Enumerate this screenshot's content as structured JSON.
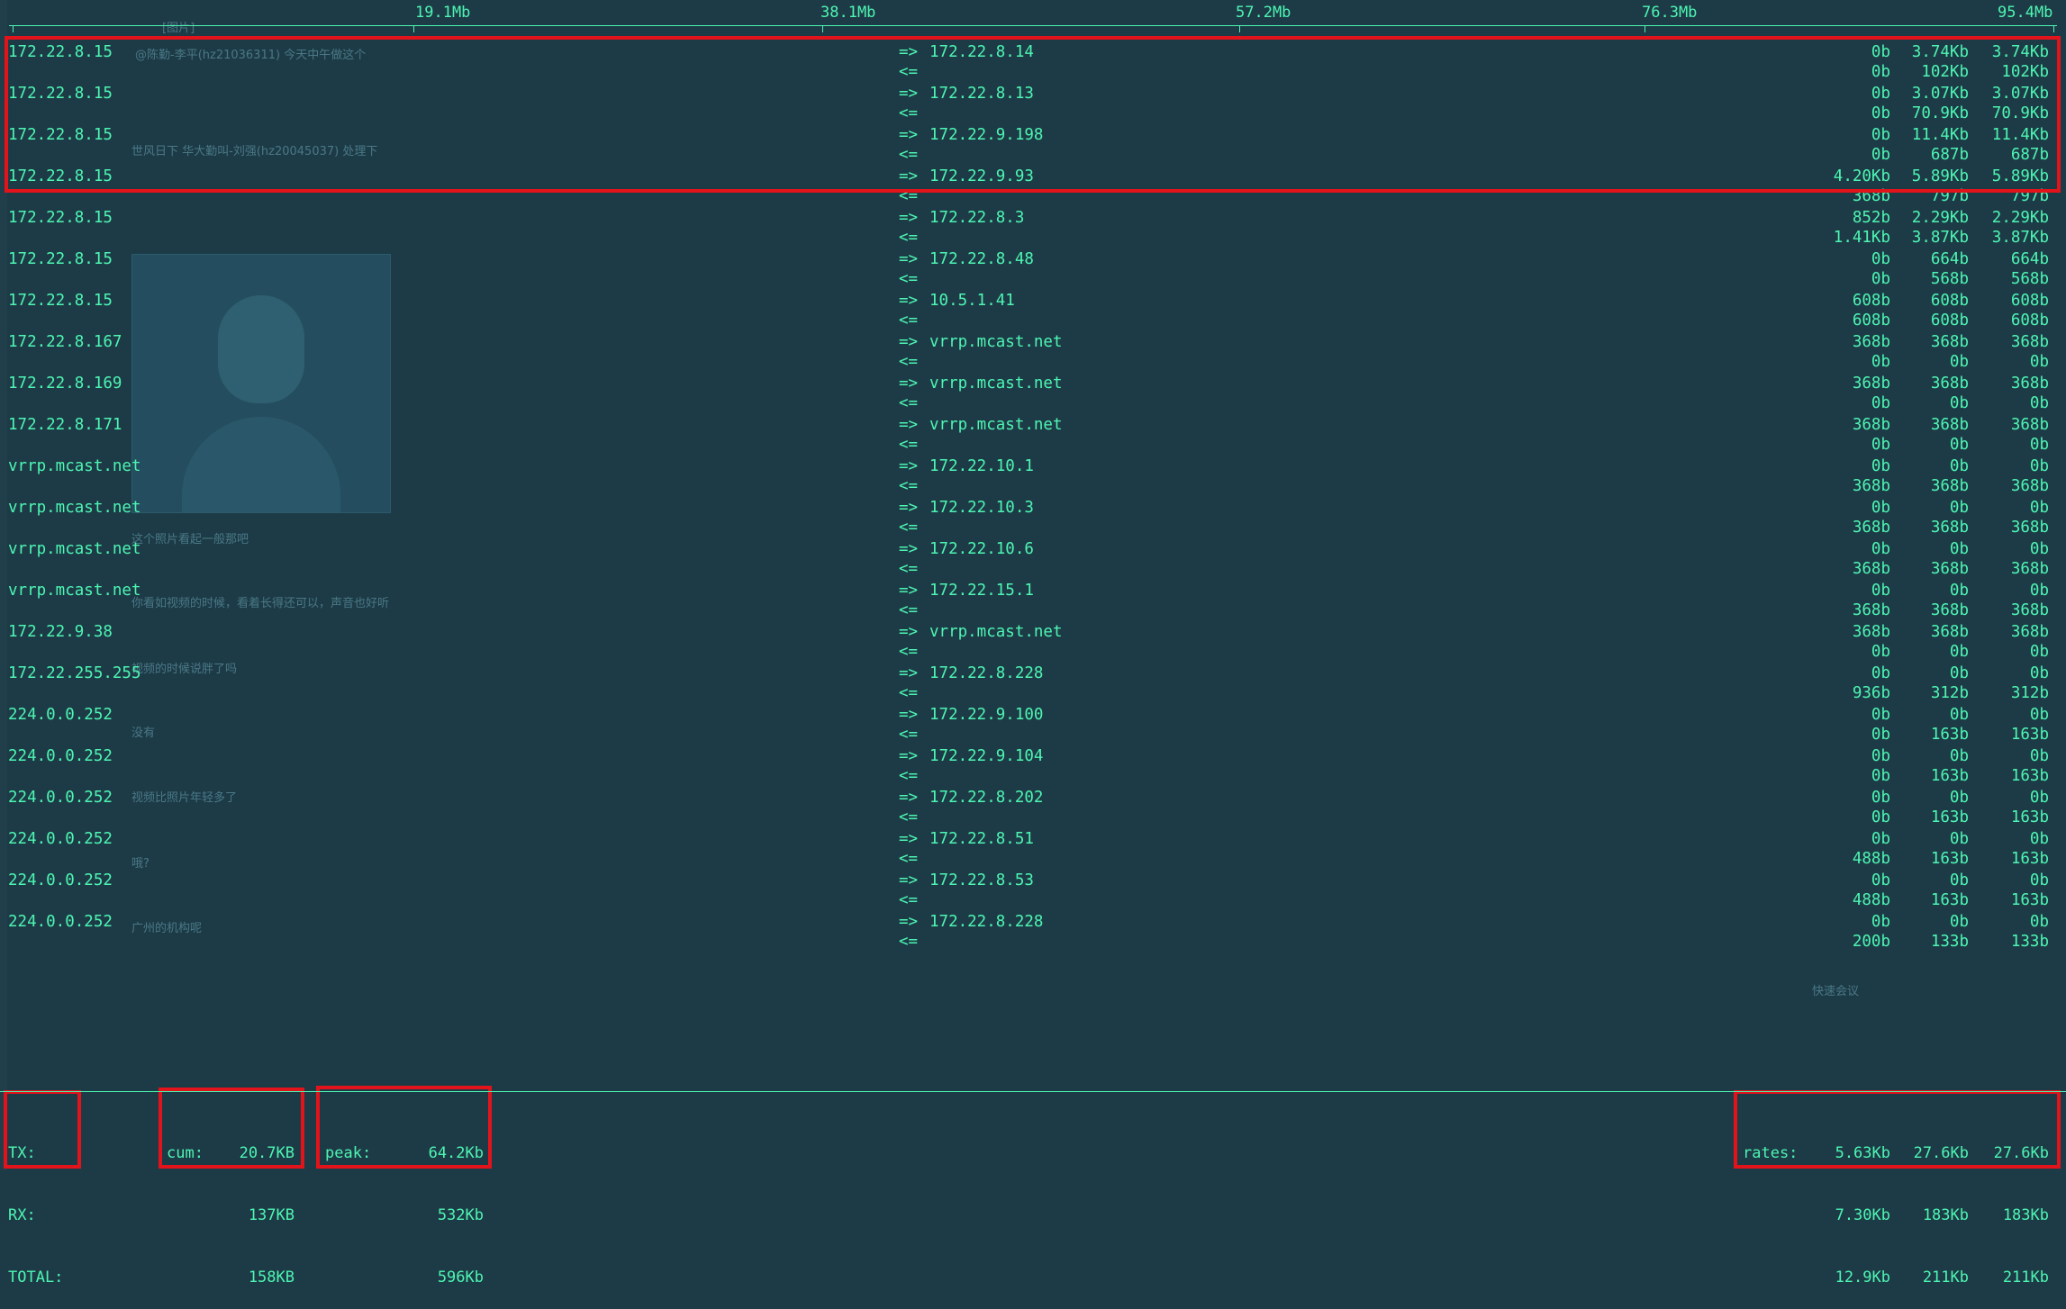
{
  "scale": {
    "labels": [
      "19.1Mb",
      "38.1Mb",
      "57.2Mb",
      "76.3Mb",
      "95.4Mb"
    ]
  },
  "arrows": {
    "out": "=>",
    "in": "<="
  },
  "connections": [
    {
      "src": "172.22.8.15",
      "dst": "172.22.8.14",
      "out": [
        "0b",
        "3.74Kb",
        "3.74Kb"
      ],
      "in": [
        "0b",
        "102Kb",
        "102Kb"
      ]
    },
    {
      "src": "172.22.8.15",
      "dst": "172.22.8.13",
      "out": [
        "0b",
        "3.07Kb",
        "3.07Kb"
      ],
      "in": [
        "0b",
        "70.9Kb",
        "70.9Kb"
      ]
    },
    {
      "src": "172.22.8.15",
      "dst": "172.22.9.198",
      "out": [
        "0b",
        "11.4Kb",
        "11.4Kb"
      ],
      "in": [
        "0b",
        "687b",
        "687b"
      ]
    },
    {
      "src": "172.22.8.15",
      "dst": "172.22.9.93",
      "out": [
        "4.20Kb",
        "5.89Kb",
        "5.89Kb"
      ],
      "in": [
        "368b",
        "797b",
        "797b"
      ]
    },
    {
      "src": "172.22.8.15",
      "dst": "172.22.8.3",
      "out": [
        "852b",
        "2.29Kb",
        "2.29Kb"
      ],
      "in": [
        "1.41Kb",
        "3.87Kb",
        "3.87Kb"
      ]
    },
    {
      "src": "172.22.8.15",
      "dst": "172.22.8.48",
      "out": [
        "0b",
        "664b",
        "664b"
      ],
      "in": [
        "0b",
        "568b",
        "568b"
      ]
    },
    {
      "src": "172.22.8.15",
      "dst": "10.5.1.41",
      "out": [
        "608b",
        "608b",
        "608b"
      ],
      "in": [
        "608b",
        "608b",
        "608b"
      ]
    },
    {
      "src": "172.22.8.167",
      "dst": "vrrp.mcast.net",
      "out": [
        "368b",
        "368b",
        "368b"
      ],
      "in": [
        "0b",
        "0b",
        "0b"
      ]
    },
    {
      "src": "172.22.8.169",
      "dst": "vrrp.mcast.net",
      "out": [
        "368b",
        "368b",
        "368b"
      ],
      "in": [
        "0b",
        "0b",
        "0b"
      ]
    },
    {
      "src": "172.22.8.171",
      "dst": "vrrp.mcast.net",
      "out": [
        "368b",
        "368b",
        "368b"
      ],
      "in": [
        "0b",
        "0b",
        "0b"
      ]
    },
    {
      "src": "vrrp.mcast.net",
      "dst": "172.22.10.1",
      "out": [
        "0b",
        "0b",
        "0b"
      ],
      "in": [
        "368b",
        "368b",
        "368b"
      ]
    },
    {
      "src": "vrrp.mcast.net",
      "dst": "172.22.10.3",
      "out": [
        "0b",
        "0b",
        "0b"
      ],
      "in": [
        "368b",
        "368b",
        "368b"
      ]
    },
    {
      "src": "vrrp.mcast.net",
      "dst": "172.22.10.6",
      "out": [
        "0b",
        "0b",
        "0b"
      ],
      "in": [
        "368b",
        "368b",
        "368b"
      ]
    },
    {
      "src": "vrrp.mcast.net",
      "dst": "172.22.15.1",
      "out": [
        "0b",
        "0b",
        "0b"
      ],
      "in": [
        "368b",
        "368b",
        "368b"
      ]
    },
    {
      "src": "172.22.9.38",
      "dst": "vrrp.mcast.net",
      "out": [
        "368b",
        "368b",
        "368b"
      ],
      "in": [
        "0b",
        "0b",
        "0b"
      ]
    },
    {
      "src": "172.22.255.255",
      "dst": "172.22.8.228",
      "out": [
        "0b",
        "0b",
        "0b"
      ],
      "in": [
        "936b",
        "312b",
        "312b"
      ]
    },
    {
      "src": "224.0.0.252",
      "dst": "172.22.9.100",
      "out": [
        "0b",
        "0b",
        "0b"
      ],
      "in": [
        "0b",
        "163b",
        "163b"
      ]
    },
    {
      "src": "224.0.0.252",
      "dst": "172.22.9.104",
      "out": [
        "0b",
        "0b",
        "0b"
      ],
      "in": [
        "0b",
        "163b",
        "163b"
      ]
    },
    {
      "src": "224.0.0.252",
      "dst": "172.22.8.202",
      "out": [
        "0b",
        "0b",
        "0b"
      ],
      "in": [
        "0b",
        "163b",
        "163b"
      ]
    },
    {
      "src": "224.0.0.252",
      "dst": "172.22.8.51",
      "out": [
        "0b",
        "0b",
        "0b"
      ],
      "in": [
        "488b",
        "163b",
        "163b"
      ]
    },
    {
      "src": "224.0.0.252",
      "dst": "172.22.8.53",
      "out": [
        "0b",
        "0b",
        "0b"
      ],
      "in": [
        "488b",
        "163b",
        "163b"
      ]
    },
    {
      "src": "224.0.0.252",
      "dst": "172.22.8.228",
      "out": [
        "0b",
        "0b",
        "0b"
      ],
      "in": [
        "200b",
        "133b",
        "133b"
      ]
    }
  ],
  "footer": {
    "labels": {
      "tx": "TX:",
      "rx": "RX:",
      "total": "TOTAL:"
    },
    "cum": {
      "label": "cum:",
      "tx": "20.7KB",
      "rx": "137KB",
      "total": "158KB"
    },
    "peak": {
      "label": "peak:",
      "tx": "64.2Kb",
      "rx": "532Kb",
      "total": "596Kb"
    },
    "rates": {
      "label": "rates:",
      "tx": [
        "5.63Kb",
        "27.6Kb",
        "27.6Kb"
      ],
      "rx": [
        "7.30Kb",
        "183Kb",
        "183Kb"
      ],
      "total": [
        "12.9Kb",
        "211Kb",
        "211Kb"
      ]
    }
  },
  "background": {
    "chat_lines": [
      "@陈勤-李平(hz21036311) 今天中午做这个",
      "世风日下 华大勤叫-刘强(hz20045037) 处理下",
      "这个照片看起一般那吧",
      "你看如视频的时候，看着长得还可以，声音也好听",
      "视频的时候说胖了吗",
      "没有",
      "视频比照片年轻多了",
      "哦?",
      "广州的机构呢",
      "[图片]",
      "快速会议"
    ]
  },
  "colors": {
    "background": "#1d3b47",
    "text": "#4df5b2",
    "highlight": "#e3131b"
  }
}
